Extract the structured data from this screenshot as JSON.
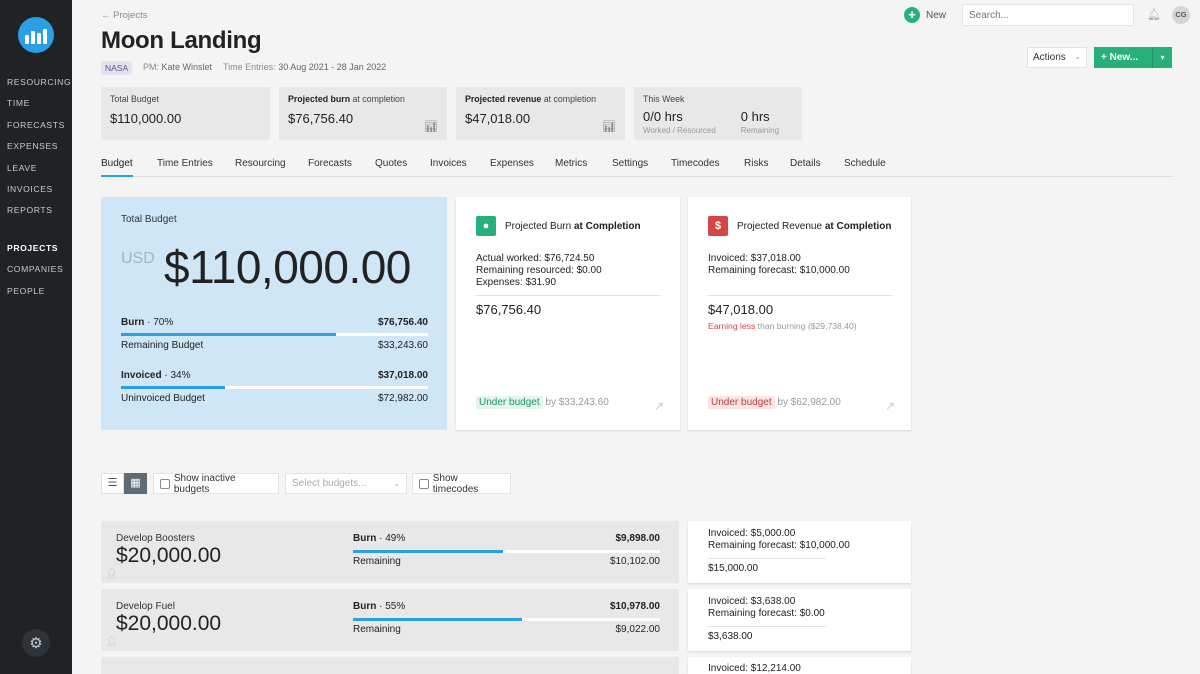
{
  "sidebar": {
    "nav_top": [
      "RESOURCING",
      "TIME",
      "FORECASTS",
      "EXPENSES",
      "LEAVE",
      "INVOICES",
      "REPORTS"
    ],
    "nav_bottom": [
      "PROJECTS",
      "COMPANIES",
      "PEOPLE"
    ],
    "active": "PROJECTS",
    "logo_icon": "bars-logo-icon",
    "settings_icon": "gear-icon"
  },
  "header": {
    "back_label": "← Projects",
    "title": "Moon Landing",
    "client": "NASA",
    "pm_label": "PM:",
    "pm_value": "Kate Winslet",
    "time_label": "Time Entries:",
    "time_value": "30 Aug 2021 - 28 Jan 2022",
    "new_label": "New",
    "search_placeholder": "Search...",
    "avatar_initials": "CG",
    "actions_label": "Actions",
    "new_button_label": "+ New..."
  },
  "stats": {
    "total_budget_label": "Total Budget",
    "total_budget_value": "$110,000.00",
    "burn_label_bold": "Projected burn",
    "burn_label_rest": " at completion",
    "burn_value": "$76,756.40",
    "revenue_label_bold": "Projected revenue",
    "revenue_label_rest": " at completion",
    "revenue_value": "$47,018.00",
    "week_label": "This Week",
    "week_worked_value": "0/0 hrs",
    "week_worked_sub": "Worked / Resourced",
    "week_remaining_value": "0 hrs",
    "week_remaining_sub": "Remaining"
  },
  "tabs": [
    "Budget",
    "Time Entries",
    "Resourcing",
    "Forecasts",
    "Quotes",
    "Invoices",
    "Expenses",
    "Metrics",
    "Settings",
    "Timecodes",
    "Risks",
    "Details",
    "Schedule"
  ],
  "active_tab": "Budget",
  "budget_card": {
    "label": "Total Budget",
    "currency": "USD",
    "amount": "$110,000.00",
    "burn_label": "Burn",
    "burn_pct_text": " · 70%",
    "burn_pct": 0.7,
    "burn_value": "$76,756.40",
    "remaining_label": "Remaining Budget",
    "remaining_value": "$33,243.60",
    "invoiced_label": "Invoiced",
    "invoiced_pct_text": " · 34%",
    "invoiced_pct": 0.34,
    "invoiced_value": "$37,018.00",
    "uninvoiced_label": "Uninvoiced Budget",
    "uninvoiced_value": "$72,982.00"
  },
  "burn_card": {
    "title": "Projected Burn ",
    "title_bold": "at Completion",
    "icon": "drop-icon",
    "color": "#27b07a",
    "line1": "Actual worked: $76,724.50",
    "line2": "Remaining resourced: $0.00",
    "line3": "Expenses: $31.90",
    "total": "$76,756.40",
    "status_tag": "Under budget",
    "status_rest": " by $33,243.60"
  },
  "revenue_card": {
    "title": "Projected Revenue ",
    "title_bold": "at Completion",
    "icon": "dollar-icon",
    "color": "#d64545",
    "line1": "Invoiced: $37,018.00",
    "line2": "Remaining forecast: $10,000.00",
    "total": "$47,018.00",
    "note_red": "Earning less",
    "note_rest": " than burning ($29,738.40)",
    "status_tag": "Under budget",
    "status_rest": " by $62,982.00"
  },
  "toolbar": {
    "list_icon": "list-icon",
    "grid_icon": "grid-icon",
    "show_inactive": "Show inactive budgets",
    "select_placeholder": "Select budgets...",
    "show_timecodes": "Show timecodes"
  },
  "budget_rows": [
    {
      "name": "Develop Boosters",
      "amount": "$20,000.00",
      "burn_label": "Burn",
      "burn_pct_text": " · 49%",
      "burn_pct": 0.49,
      "burn_value": "$9,898.00",
      "remaining_label": "Remaining",
      "remaining_value": "$10,102.00",
      "invoiced": "Invoiced: $5,000.00",
      "forecast": "Remaining forecast: $10,000.00",
      "total": "$15,000.00"
    },
    {
      "name": "Develop Fuel",
      "amount": "$20,000.00",
      "burn_label": "Burn",
      "burn_pct_text": " · 55%",
      "burn_pct": 0.55,
      "burn_value": "$10,978.00",
      "remaining_label": "Remaining",
      "remaining_value": "$9,022.00",
      "invoiced": "Invoiced: $3,638.00",
      "forecast": "Remaining forecast: $0.00",
      "total": "$3,638.00"
    }
  ],
  "partial_row_invoiced": "Invoiced: $12,214.00"
}
